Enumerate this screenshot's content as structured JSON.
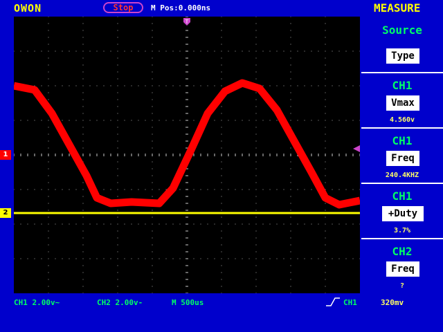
{
  "header": {
    "brand": "OWON",
    "run_state": "Stop",
    "position": "M Pos:0.000ns"
  },
  "measure": {
    "title": "MEASURE",
    "cells": [
      {
        "head": "Source",
        "box": "Type",
        "value": ""
      },
      {
        "head": "CH1",
        "box": "Vmax",
        "value": "4.560v"
      },
      {
        "head": "CH1",
        "box": "Freq",
        "value": "240.4KHZ"
      },
      {
        "head": "CH1",
        "box": "+Duty",
        "value": "3.7%"
      },
      {
        "head": "CH2",
        "box": "Freq",
        "value": "?"
      }
    ]
  },
  "status": {
    "ch1_scale": "CH1 2.00v~",
    "ch2_scale": "CH2 2.00v-",
    "timebase": "M 500us",
    "trigger_source": "CH1",
    "trigger_level": "320mv"
  },
  "markers": {
    "ch1": "1",
    "ch2": "2",
    "trigger_time": "T"
  },
  "colors": {
    "ch1_trace": "#ff0000",
    "ch2_trace": "#ffff00",
    "grid": "#ffffff",
    "panel_bg": "#0000cc"
  }
}
